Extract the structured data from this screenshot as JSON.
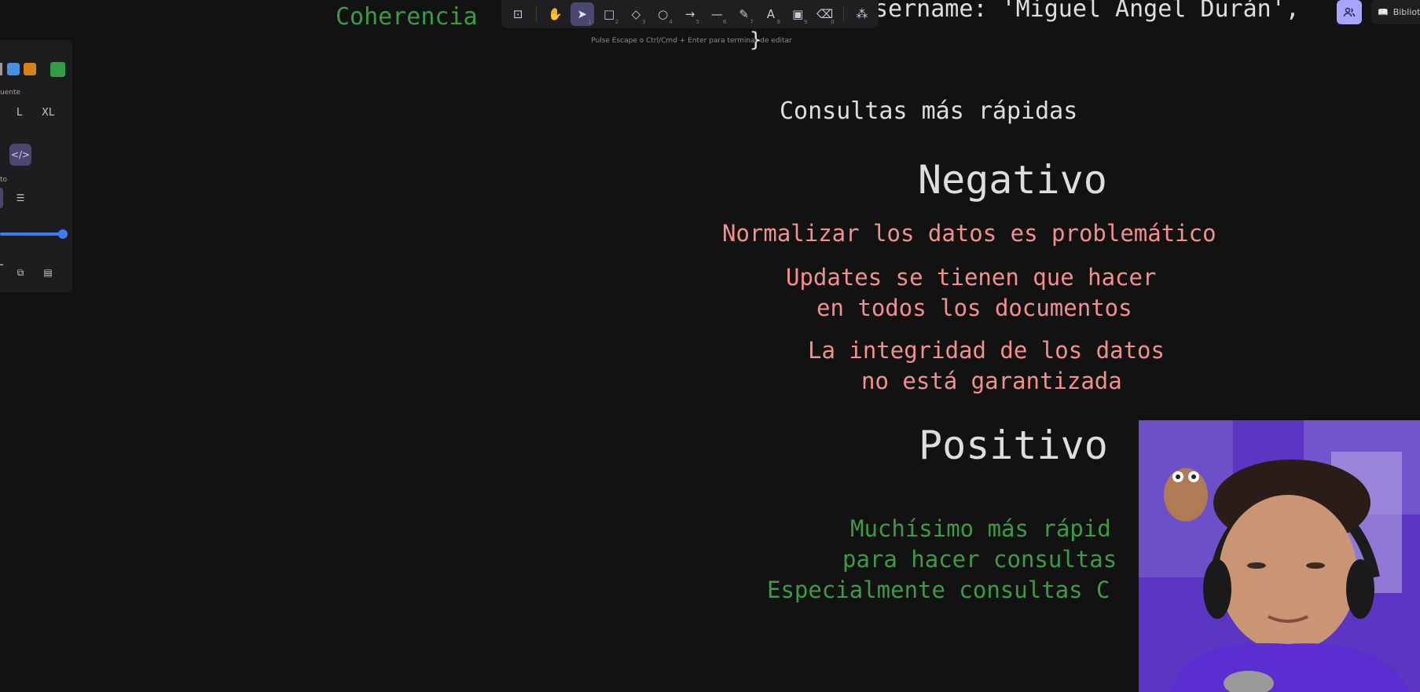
{
  "canvas": {
    "coherencia": "Coherencia",
    "username_line": "sername: 'Miguel Angel Durán',",
    "brace": "}",
    "consultas_rapidas": "Consultas más rápidas",
    "negativo_title": "Negativo",
    "neg_1": "Normalizar los datos es problemático",
    "neg_2a": "Updates se tienen que hacer",
    "neg_2b": "en todos los documentos",
    "neg_3a": "La integridad de los datos",
    "neg_3b": "no está garantizada",
    "positivo_title": "Positivo",
    "pos_1": "Muchísimo más rápid",
    "pos_2": "para hacer consultas",
    "pos_3": "Especialmente consultas C"
  },
  "toolbar": {
    "hint": "Pulse Escape o Ctrl/Cmd + Enter para terminar de editar",
    "tools": [
      {
        "icon": "lock-icon",
        "glyph": "⊡",
        "num": ""
      },
      {
        "icon": "hand-icon",
        "glyph": "✋",
        "num": ""
      },
      {
        "icon": "pointer-icon",
        "glyph": "➤",
        "num": "1"
      },
      {
        "icon": "rectangle-icon",
        "glyph": "□",
        "num": "2"
      },
      {
        "icon": "diamond-icon",
        "glyph": "◇",
        "num": "3"
      },
      {
        "icon": "ellipse-icon",
        "glyph": "○",
        "num": "4"
      },
      {
        "icon": "arrow-icon",
        "glyph": "→",
        "num": "5"
      },
      {
        "icon": "line-icon",
        "glyph": "—",
        "num": "6"
      },
      {
        "icon": "pencil-icon",
        "glyph": "✎",
        "num": "7"
      },
      {
        "icon": "text-icon",
        "glyph": "A",
        "num": "8"
      },
      {
        "icon": "image-icon",
        "glyph": "▣",
        "num": "9"
      },
      {
        "icon": "eraser-icon",
        "glyph": "⌫",
        "num": "0"
      },
      {
        "icon": "shapes-icon",
        "glyph": "⁂",
        "num": ""
      }
    ]
  },
  "props_panel": {
    "font_label": "uente",
    "size_l": "L",
    "size_xl": "XL",
    "align_label": "to",
    "swatches": [
      "#4a90e2",
      "#d9801a",
      "#2f9e44"
    ]
  },
  "top_right": {
    "library_label": "Bibliote"
  }
}
